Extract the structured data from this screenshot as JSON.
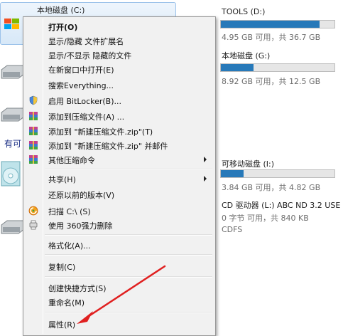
{
  "drives": {
    "c": {
      "name": "本地磁盘 (C:)"
    },
    "d": {
      "name": "TOOLS (D:)",
      "info": "4.95 GB 可用，共 36.7 GB",
      "used_fraction": 0.87
    },
    "g": {
      "name": "本地磁盘 (G:)",
      "info": "8.92 GB 可用，共 12.5 GB",
      "used_fraction": 0.29
    },
    "i": {
      "name": "可移动磁盘 (I:)",
      "info": "3.84 GB 可用，共 4.82 GB",
      "used_fraction": 0.2
    },
    "l": {
      "name": "CD 驱动器 (L:) ABC ND 3.2 USE",
      "info": "0 字节 可用，共 840 KB",
      "fs": "CDFS"
    },
    "section_label": "有可"
  },
  "context_menu": {
    "items": [
      {
        "label": "打开(O)"
      },
      {
        "label": "显示/隐藏 文件扩展名"
      },
      {
        "label": "显示/不显示 隐藏的文件"
      },
      {
        "label": "在新窗口中打开(E)"
      },
      {
        "label": "搜索Everything..."
      },
      {
        "label": "启用 BitLocker(B)...",
        "icon": "shield-icon"
      },
      {
        "label": "添加到压缩文件(A) ...",
        "icon": "archive-icon"
      },
      {
        "label": "添加到 \"新建压缩文件.zip\"(T)",
        "icon": "archive-icon"
      },
      {
        "label": "添加到 \"新建压缩文件.zip\" 并邮件",
        "icon": "archive-icon"
      },
      {
        "label": "其他压缩命令",
        "icon": "archive-icon",
        "submenu": true
      },
      {
        "label": "共享(H)",
        "submenu": true
      },
      {
        "label": "还原以前的版本(V)"
      },
      {
        "label": "扫描 C:\\ (S)",
        "icon": "360-scan-icon"
      },
      {
        "label": "使用 360强力删除",
        "icon": "360-delete-icon"
      },
      {
        "label": "格式化(A)..."
      },
      {
        "label": "复制(C)"
      },
      {
        "label": "创建快捷方式(S)"
      },
      {
        "label": "重命名(M)"
      },
      {
        "label": "属性(R)"
      }
    ]
  },
  "colors": {
    "menu_bg": "#f1f1f1",
    "bar_fill": "#2779b9",
    "annotation_arrow": "#e02020"
  }
}
